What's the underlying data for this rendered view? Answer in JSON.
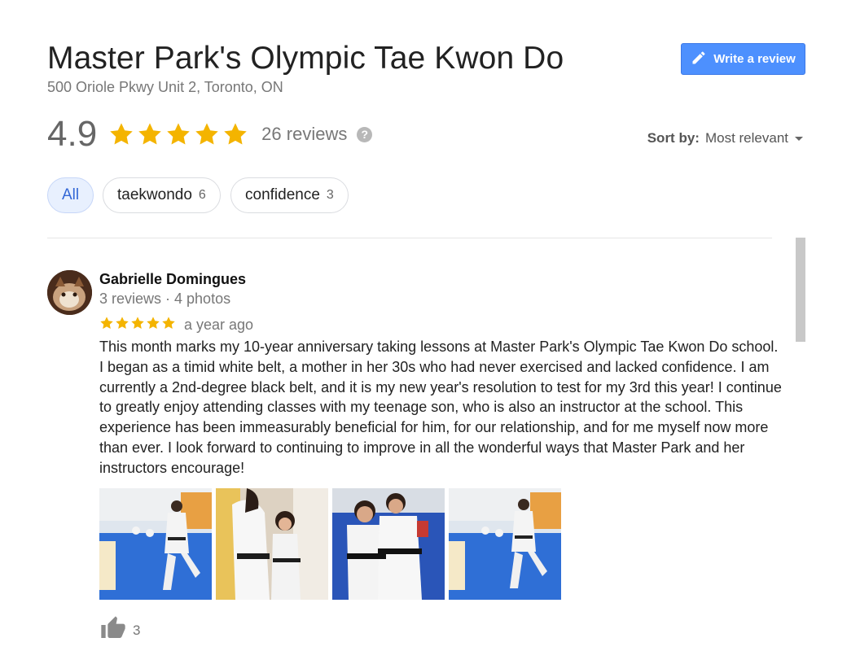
{
  "business": {
    "name": "Master Park's Olympic Tae Kwon Do",
    "address": "500 Oriole Pkwy Unit 2, Toronto, ON",
    "rating": "4.9",
    "rating_stars": 5,
    "review_count": "26 reviews",
    "help_icon": "?"
  },
  "write_review": {
    "label": "Write a review",
    "icon": "pencil-icon"
  },
  "sort": {
    "label": "Sort by:",
    "value": "Most relevant"
  },
  "filters": [
    {
      "label": "All",
      "count": ""
    },
    {
      "label": "taekwondo",
      "count": "6"
    },
    {
      "label": "confidence",
      "count": "3"
    }
  ],
  "review": {
    "author": "Gabrielle Domingues",
    "meta": "3 reviews · 4 photos",
    "stars": 5,
    "date": "a year ago",
    "text": "This month marks my 10-year anniversary taking lessons at Master Park's Olympic Tae Kwon Do school. I began as a timid white belt, a mother in her 30s who had never exercised and lacked confidence. I am currently a 2nd-degree black belt, and it is my new year's resolution to test for my 3rd this year! I continue to greatly enjoy attending classes with my teenage son, who is also an instructor at the school. This experience has been immeasurably beneficial for him, for our relationship, and for me myself now more than ever. I look forward to continuing to improve in all the wonderful ways that Master Park and her instructors encourage!",
    "likes": "3"
  },
  "colors": {
    "star": "#f4b400",
    "accent": "#4d90fe",
    "chip_active_bg": "#e8f0fe",
    "chip_active_text": "#3367d6"
  }
}
